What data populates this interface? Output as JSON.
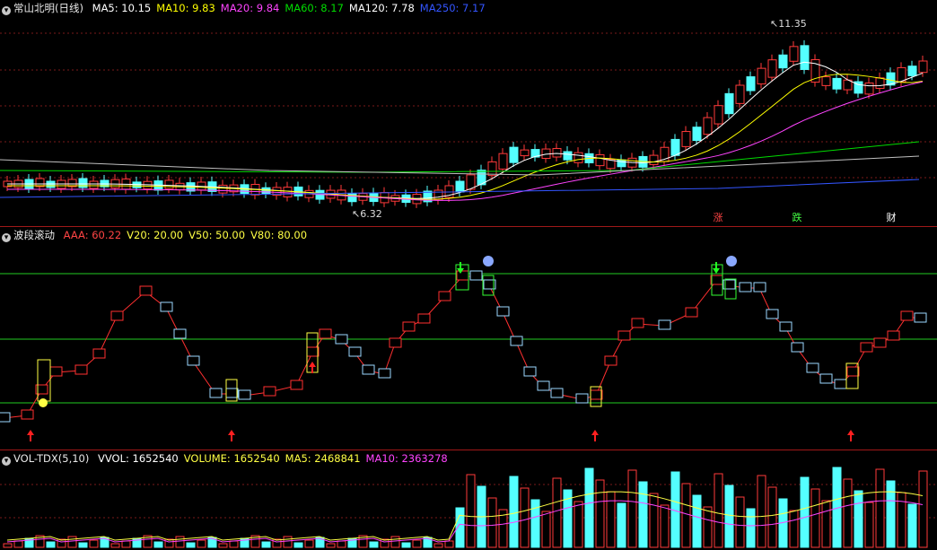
{
  "main": {
    "title": "常山北明(日线)",
    "ma": [
      {
        "label": "MA5: 10.15",
        "color": "#ffffff"
      },
      {
        "label": "MA10: 9.83",
        "color": "#ffff00"
      },
      {
        "label": "MA20: 9.84",
        "color": "#ff44ff"
      },
      {
        "label": "MA60: 8.17",
        "color": "#00dd00"
      },
      {
        "label": "MA120: 7.78",
        "color": "#ffffff"
      },
      {
        "label": "MA250: 7.17",
        "color": "#3355ff"
      }
    ],
    "high_label": "11.35",
    "low_label": "6.32",
    "events": [
      {
        "text": "涨",
        "color": "#ff4444"
      },
      {
        "text": "跌",
        "color": "#44ff44"
      },
      {
        "text": "财",
        "color": "#ffffff"
      }
    ]
  },
  "wave": {
    "title": "波段滚动",
    "values": [
      {
        "label": "AAA: 60.22",
        "color": "#ff4444"
      },
      {
        "label": "V20: 20.00",
        "color": "#ffff44"
      },
      {
        "label": "V50: 50.00",
        "color": "#ffff44"
      },
      {
        "label": "V80: 80.00",
        "color": "#ffff44"
      }
    ]
  },
  "vol": {
    "title": "VOL-TDX(5,10)",
    "values": [
      {
        "label": "VVOL: 1652540",
        "color": "#ffffff"
      },
      {
        "label": "VOLUME: 1652540",
        "color": "#ffff44"
      },
      {
        "label": "MA5: 2468841",
        "color": "#ffff44"
      },
      {
        "label": "MA10: 2363278",
        "color": "#ff44ff"
      }
    ]
  },
  "colors": {
    "up": "#ff3a3a",
    "down": "#54ffff",
    "grid": "#7a1a1a",
    "level": "#22cc22"
  }
}
